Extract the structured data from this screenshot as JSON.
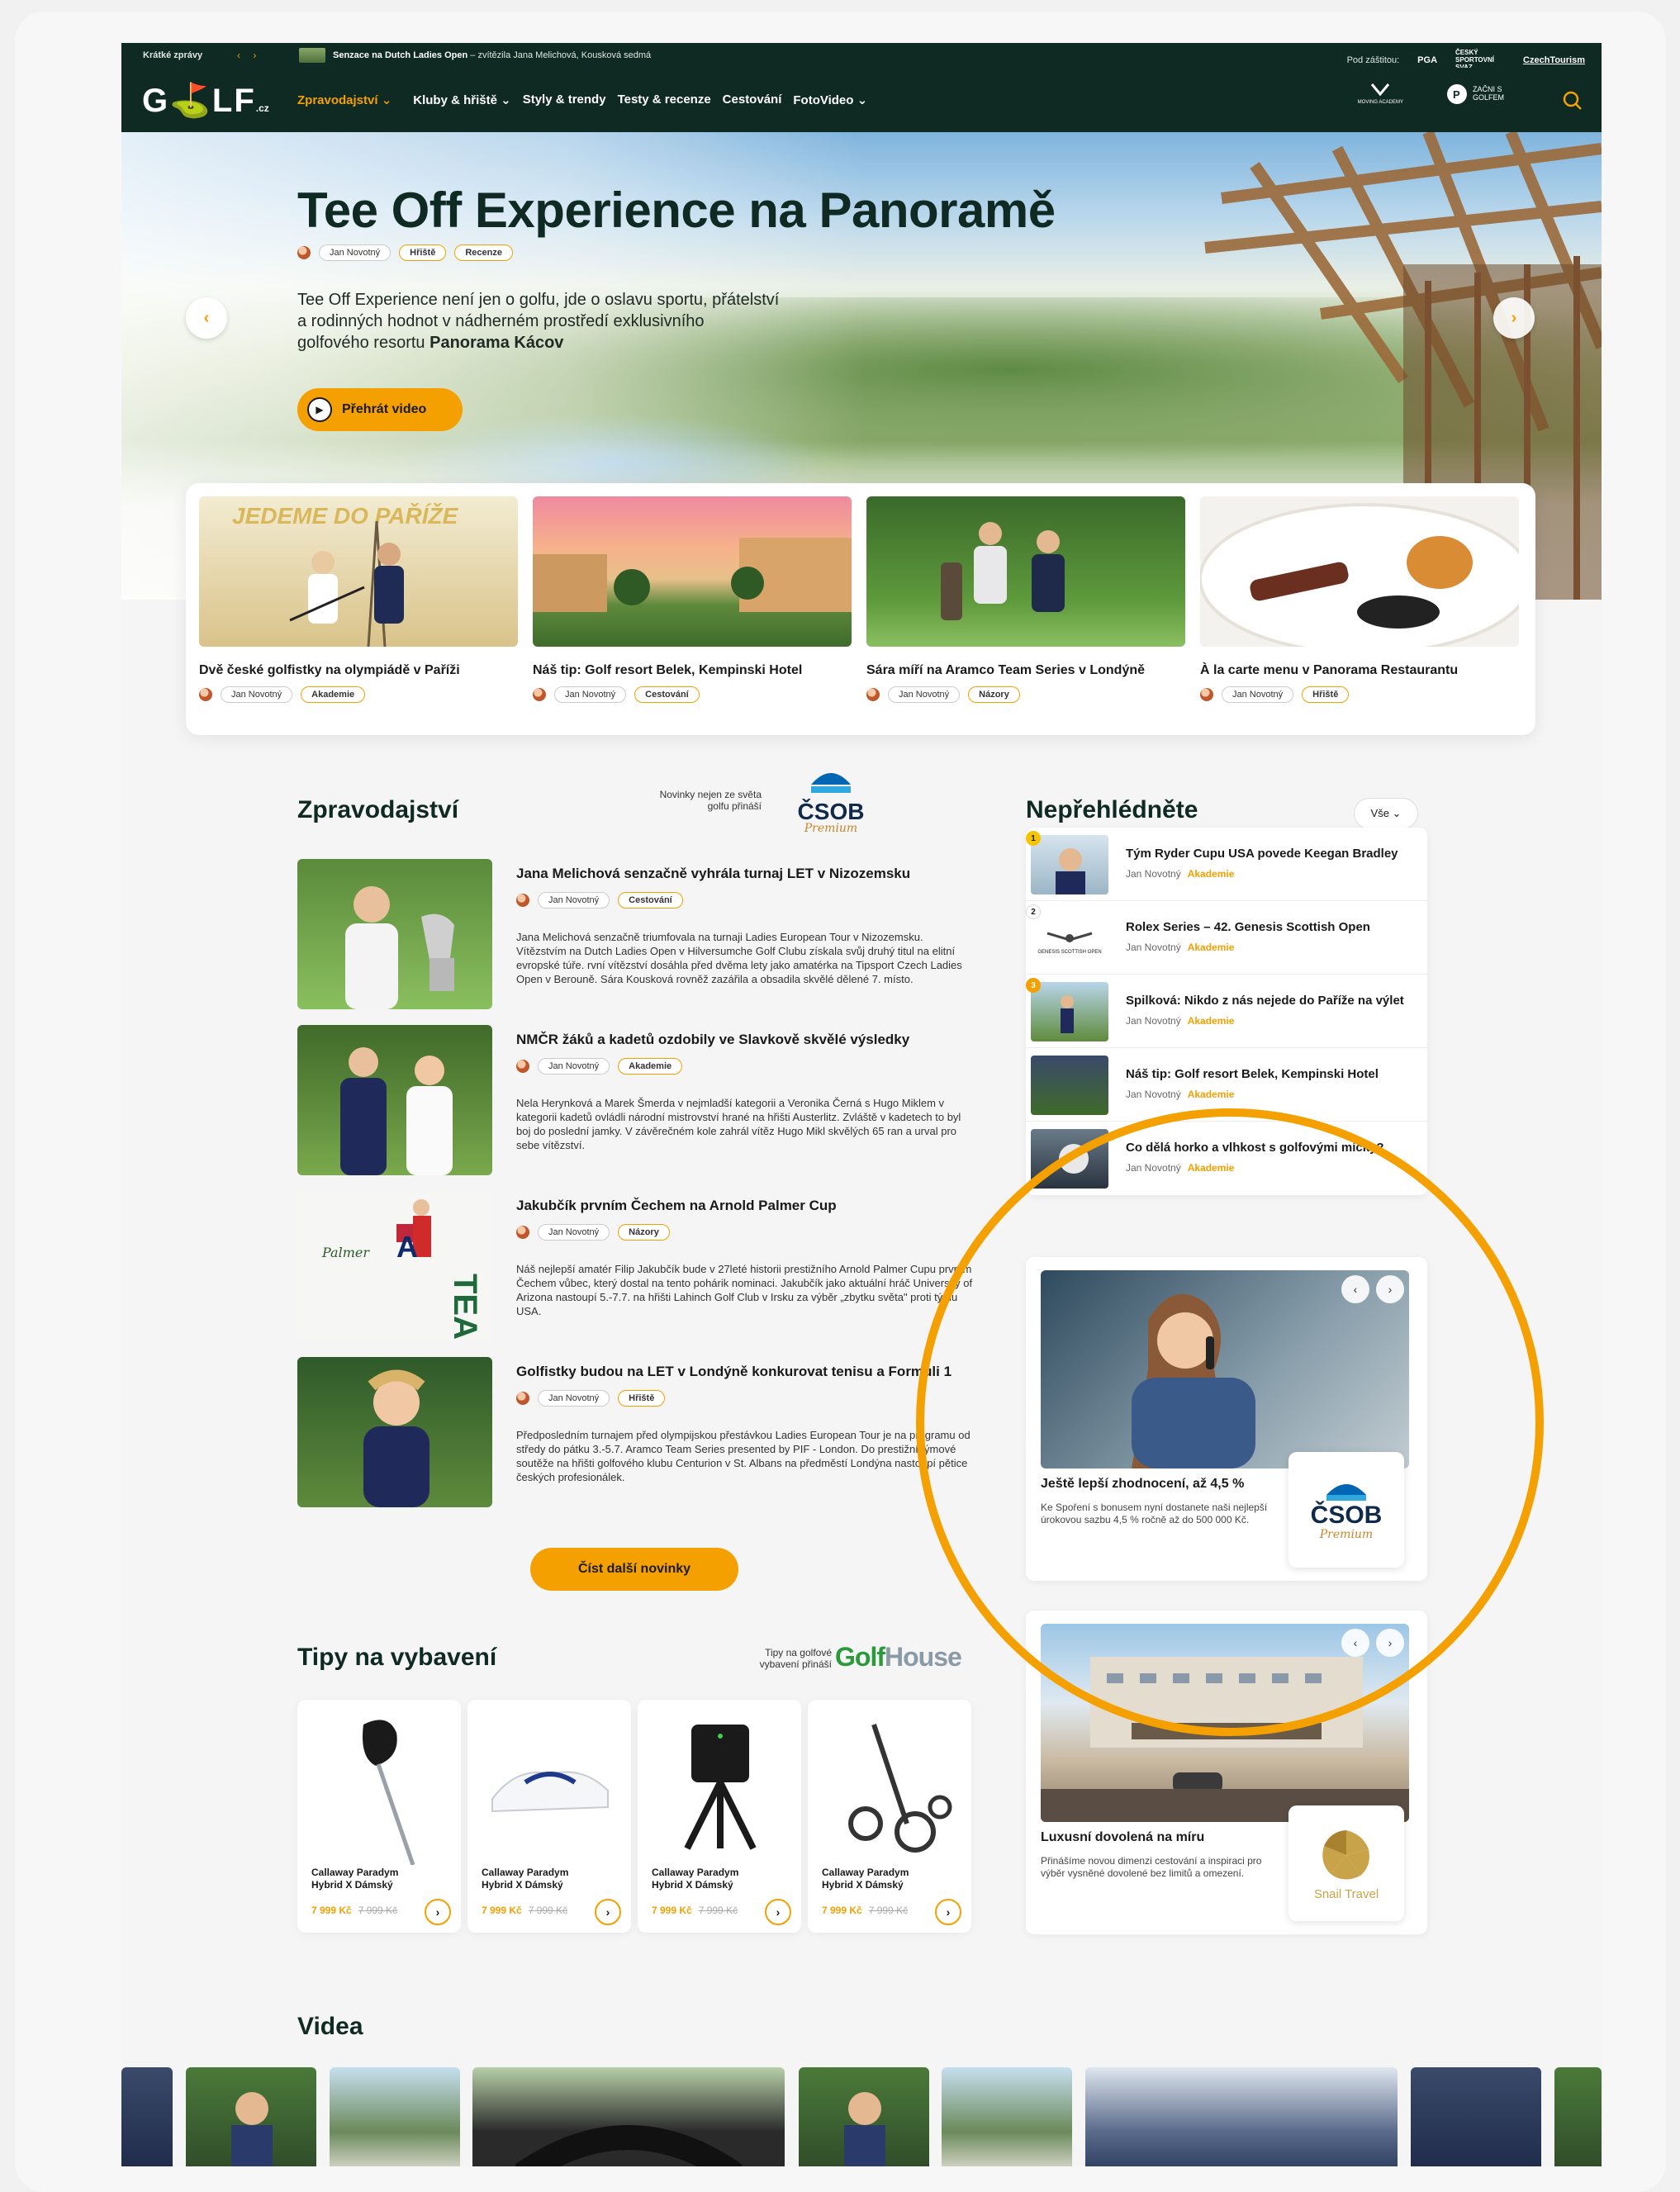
{
  "ticker": {
    "label": "Krátké zprávy",
    "arrows": "‹ ›",
    "headline_bold": "Senzace na Dutch Ladies Open",
    "headline_rest": " – zvítězila Jana Melichová, Kousková sedmá",
    "patron_label": "Pod záštitou:",
    "partner_1": "PGA",
    "partner_2": "ČESKÝ SPORTOVNÍ SVAZ",
    "partner_3": "CzechTourism"
  },
  "nav": {
    "logo": "G⛳LF",
    "logo_suffix": ".cz",
    "items": [
      "Zpravodajství ⌄",
      "Kluby & hřiště ⌄",
      "Styly & trendy",
      "Testy & recenze",
      "Cestování",
      "FotoVideo ⌄"
    ],
    "right_logo_1": "MOVING ACADEMY",
    "right_logo_2": "ZAČNI S GOLFEM"
  },
  "hero": {
    "title": "Tee Off Experience na Panoramě",
    "author": "Jan Novotný",
    "tags": [
      "Hřiště",
      "Recenze"
    ],
    "text_1": "Tee Off Experience není jen o golfu, jde o oslavu sportu, přátelství",
    "text_2": "a rodinných hodnot v nádherném prostředí exklusivního",
    "text_3": "golfového resortu ",
    "text_bold": "Panorama Kácov",
    "play_label": "Přehrát video",
    "prev": "‹",
    "next": "›"
  },
  "featured": [
    {
      "title": "Dvě české golfistky na olympiádě v Paříži",
      "author": "Jan Novotný",
      "tag": "Akademie",
      "img_text": "JEDEME DO PAŘÍŽE"
    },
    {
      "title": "Náš tip: Golf resort Belek, Kempinski Hotel",
      "author": "Jan Novotný",
      "tag": "Cestování"
    },
    {
      "title": "Sára míří na Aramco Team Series v Londýně",
      "author": "Jan Novotný",
      "tag": "Názory"
    },
    {
      "title": "À la carte menu v Panorama Restaurantu",
      "author": "Jan Novotný",
      "tag": "Hřiště"
    }
  ],
  "news_section": {
    "title": "Zpravodajství",
    "sponsor_note_1": "Novinky nejen ze světa",
    "sponsor_note_2": "golfu přináší",
    "sponsor_logo": "ČSOB",
    "sponsor_script": "Premium",
    "more_label": "Číst další novinky",
    "items": [
      {
        "title": "Jana Melichová senzačně vyhrála turnaj LET v Nizozemsku",
        "author": "Jan Novotný",
        "tag": "Cestování",
        "desc": "Jana Melichová senzačně triumfovala na turnaji Ladies European Tour v Nizozemsku. Vítězstvím na Dutch Ladies Open v Hilversumche Golf Clubu získala svůj druhý titul na elitní evropské túře. rvní vítězství dosáhla před dvěma lety jako amatérka na Tipsport Czech Ladies Open v Berouně. Sára Kousková rovněž zazářila a obsadila skvělé dělené 7. místo."
      },
      {
        "title": "NMČR žáků a kadetů ozdobily ve Slavkově skvělé výsledky",
        "author": "Jan Novotný",
        "tag": "Akademie",
        "desc": "Nela Herynková a Marek Šmerda v nejmladší kategorii a Veronika Černá s Hugo Miklem v kategorii kadetů ovládli národní mistrovství hrané na hřišti Austerlitz. Zvláště v kadetech to byl boj do poslední jamky. V závěrečném kole zahrál vítěz Hugo Mikl skvělých 65 ran a urval pro sebe vítězství."
      },
      {
        "title": "Jakubčík prvním Čechem na Arnold Palmer Cup",
        "author": "Jan Novotný",
        "tag": "Názory",
        "desc": "Náš nejlepší amatér Filip Jakubčík bude v 27leté historii prestižního Arnold Palmer Cupu prvním Čechem vůbec, který dostal na tento pohárik nominaci. Jakubčík jako aktuální hráč University of Arizona nastoupí 5.-7.7. na hřišti Lahinch Golf Club v Irsku za výběr „zbytku světa\" proti týmu USA."
      },
      {
        "title": "Golfistky budou na LET v Londýně konkurovat tenisu a Formuli 1",
        "author": "Jan Novotný",
        "tag": "Hřiště",
        "desc": "Předposledním turnajem před olympijskou přestávkou Ladies European Tour je na programu od středy do pátku 3.-5.7. Aramco Team Series presented by PIF - London. Do prestižní týmové soutěže na hřišti golfového klubu Centurion v St. Albans na předměstí Londýna nastoupí pětice českých profesionálek."
      }
    ]
  },
  "dont_miss": {
    "title": "Nepřehlédněte",
    "all_label": "Vše ⌄",
    "items": [
      {
        "num": "1",
        "title": "Tým Ryder Cupu USA povede Keegan Bradley",
        "author": "Jan Novotný",
        "tag": "Akademie"
      },
      {
        "num": "2",
        "title": "Rolex Series – 42. Genesis Scottish Open",
        "author": "Jan Novotný",
        "tag": "Akademie",
        "thumb_text": "GENESIS SCOTTISH OPEN"
      },
      {
        "num": "3",
        "title": "Spilková: Nikdo z nás nejede do Paříže na výlet",
        "author": "Jan Novotný",
        "tag": "Akademie"
      },
      {
        "num": "",
        "title": "Náš tip: Golf resort Belek, Kempinski Hotel",
        "author": "Jan Novotný",
        "tag": "Akademie"
      },
      {
        "num": "",
        "title": "Co dělá horko a vlhkost s golfovými míčky?",
        "author": "Jan Novotný",
        "tag": "Akademie"
      }
    ]
  },
  "promo_1": {
    "title": "Ještě lepší zhodnocení, až 4,5 %",
    "desc": "Ke Spoření s bonusem nyní dostanete naši nejlepší úrokovou sazbu 4,5 % ročně až do 500 000 Kč.",
    "logo": "ČSOB",
    "logo_script": "Premium"
  },
  "promo_2": {
    "title": "Luxusní dovolená na míru",
    "desc": "Přinášíme novou dimenzi cestování a inspiraci pro výběr vysněné dovolené bez limitů a omezení.",
    "logo": "Snail Travel"
  },
  "equipment": {
    "title": "Tipy na vybavení",
    "sponsor_note_1": "Tipy na golfové",
    "sponsor_note_2": "vybavení přináší",
    "sponsor_logo": "Golf",
    "sponsor_logo_2": "House",
    "products": [
      {
        "name_1": "Callaway Paradym",
        "name_2": "Hybrid X Dámský",
        "price": "7 999 Kč",
        "old_price": "7 999 Kč"
      },
      {
        "name_1": "Callaway Paradym",
        "name_2": "Hybrid X Dámský",
        "price": "7 999 Kč",
        "old_price": "7 999 Kč"
      },
      {
        "name_1": "Callaway Paradym",
        "name_2": "Hybrid X Dámský",
        "price": "7 999 Kč",
        "old_price": "7 999 Kč"
      },
      {
        "name_1": "Callaway Paradym",
        "name_2": "Hybrid X Dámský",
        "price": "7 999 Kč",
        "old_price": "7 999 Kč"
      }
    ]
  },
  "videos": {
    "title": "Videa"
  },
  "colors": {
    "accent": "#f4a000",
    "dark": "#0f2a22",
    "csob_blue": "#0065b3"
  }
}
